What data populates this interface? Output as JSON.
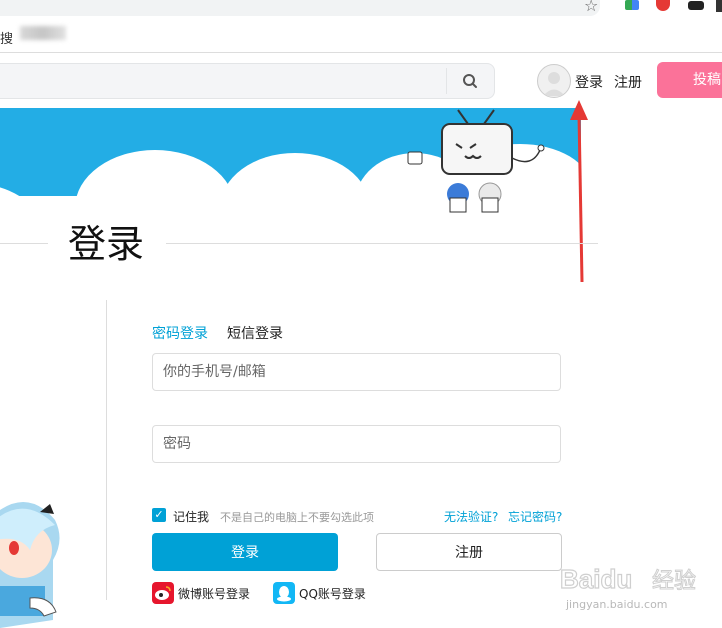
{
  "browser": {
    "bookmark_text": "搜"
  },
  "header": {
    "login_label": "登录",
    "register_label": "注册",
    "upload_label": "投稿"
  },
  "page": {
    "title": "登录"
  },
  "login_form": {
    "tabs": [
      {
        "label": "密码登录",
        "active": true
      },
      {
        "label": "短信登录",
        "active": false
      }
    ],
    "phone_placeholder": "你的手机号/邮箱",
    "password_placeholder": "密码",
    "remember_label": "记住我",
    "remember_hint": "不是自己的电脑上不要勾选此项",
    "remember_checked": true,
    "cant_verify_label": "无法验证?",
    "forgot_label": "忘记密码?",
    "login_button": "登录",
    "register_button": "注册",
    "weibo_label": "微博账号登录",
    "qq_label": "QQ账号登录"
  },
  "colors": {
    "accent": "#00a1d6",
    "upload_pink": "#fb7299",
    "annotation_red": "#e53935"
  },
  "watermark": {
    "brand": "Baidu",
    "suffix": "经验",
    "url": "jingyan.baidu.com"
  }
}
